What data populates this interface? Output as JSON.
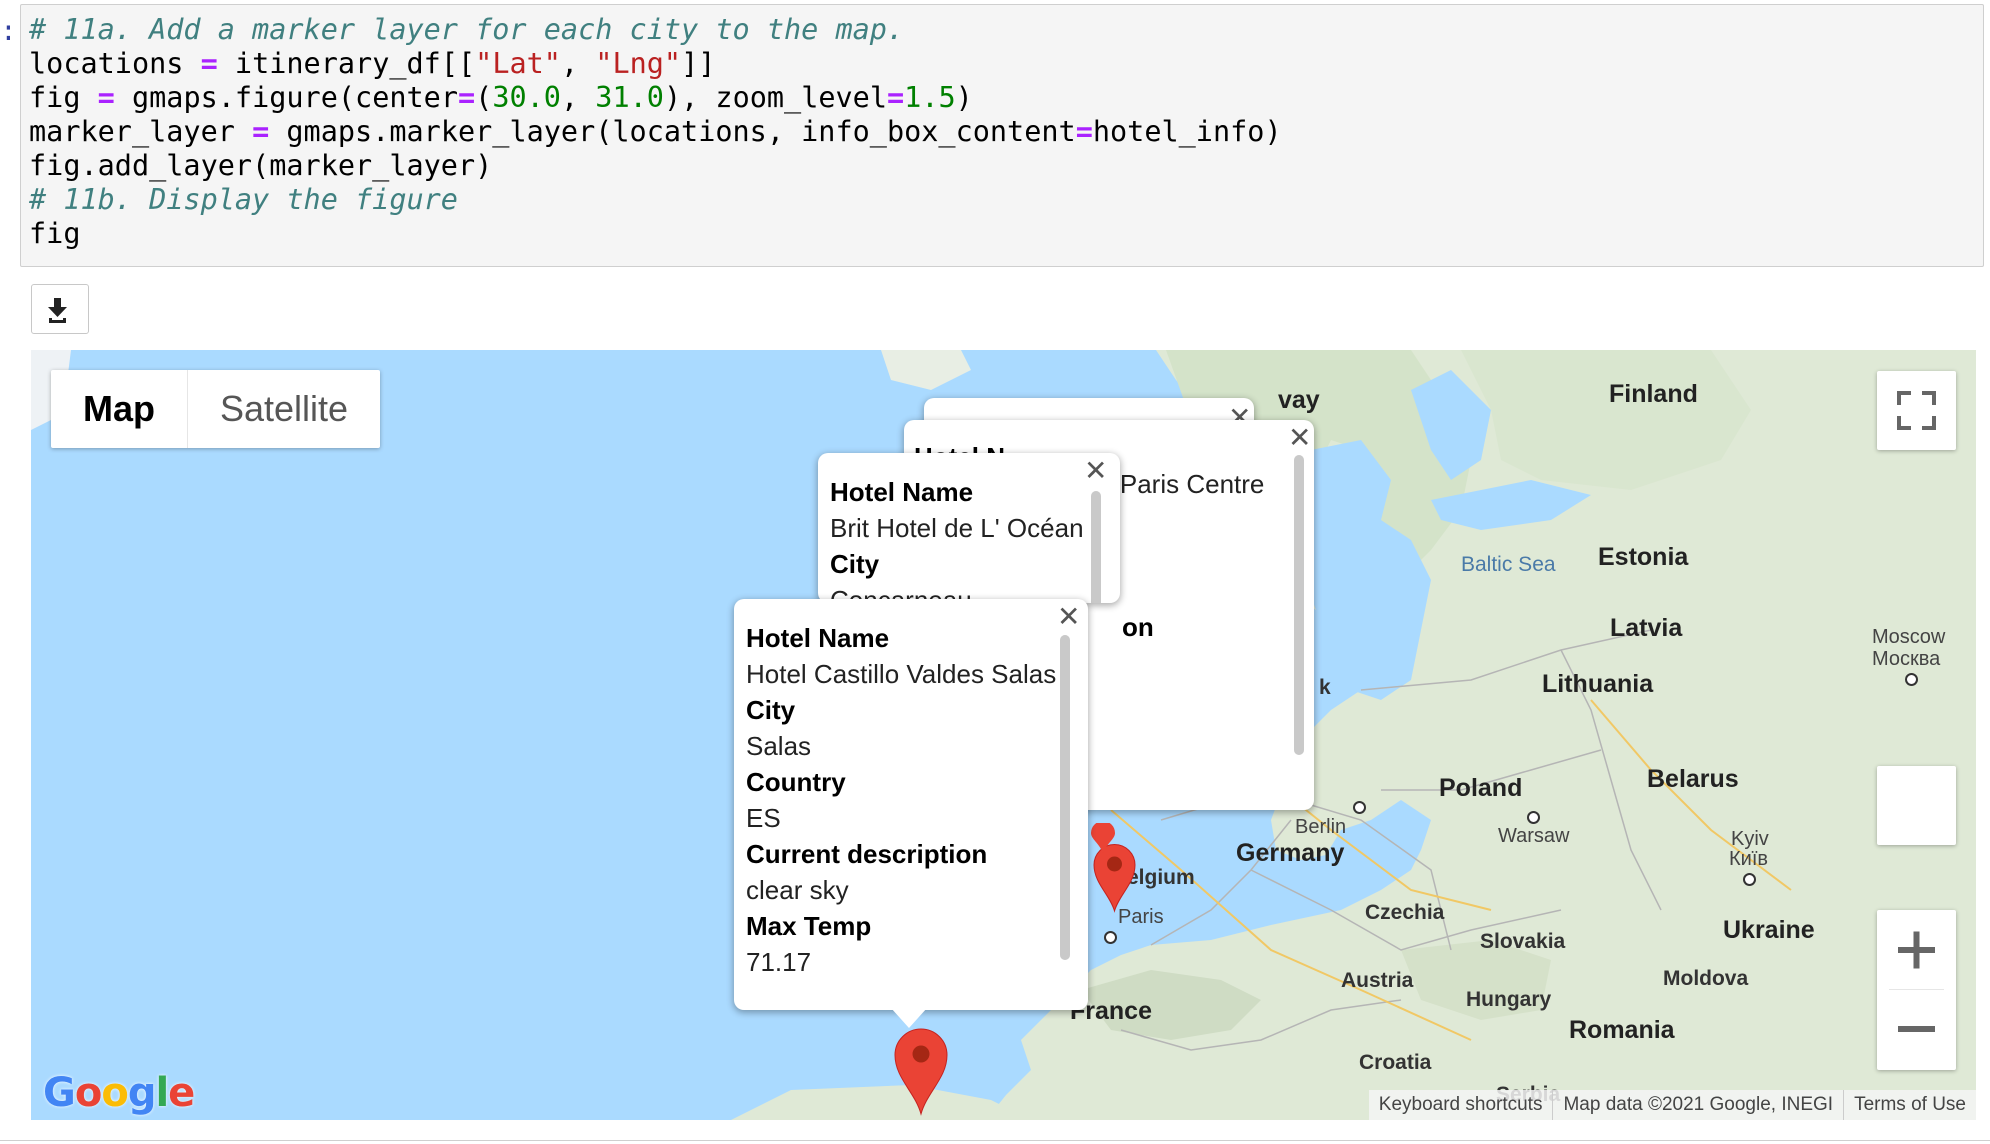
{
  "code_cell": {
    "prompt": ":",
    "lines": {
      "l1": "# 11a. Add a marker layer for each city to the map.",
      "l2a": "locations ",
      "l2b": "=",
      "l2c": " itinerary_df[[",
      "l2d": "\"Lat\"",
      "l2e": ", ",
      "l2f": "\"Lng\"",
      "l2g": "]]",
      "l3a": "fig ",
      "l3b": "=",
      "l3c": " gmaps.figure(center",
      "l3d": "=",
      "l3e": "(",
      "l3f": "30.0",
      "l3g": ", ",
      "l3h": "31.0",
      "l3i": "), zoom_level",
      "l3j": "=",
      "l3k": "1.5",
      "l3l": ")",
      "l4a": "marker_layer ",
      "l4b": "=",
      "l4c": " gmaps.marker_layer(locations, info_box_content",
      "l4d": "=",
      "l4e": "hotel_info)",
      "l5": "fig.add_layer(marker_layer)",
      "l6": "# 11b. Display the figure",
      "l7": "fig"
    }
  },
  "download_button": {
    "icon": "download-icon"
  },
  "map": {
    "map_type": {
      "map_label": "Map",
      "satellite_label": "Satellite"
    },
    "labels": {
      "finland": "Finland",
      "norway_partial": "vay",
      "estonia": "Estonia",
      "latvia": "Latvia",
      "lithuania": "Lithuania",
      "baltic_sea": "Baltic Sea",
      "moscow_en": "Moscow",
      "moscow_ru": "Москва",
      "poland": "Poland",
      "belarus": "Belarus",
      "warsaw": "Warsaw",
      "germany": "Germany",
      "berlin": "Berlin",
      "belgium": "elgium",
      "paris": "Paris",
      "czechia": "Czechia",
      "slovakia": "Slovakia",
      "ukraine": "Ukraine",
      "kyiv_en": "Kyiv",
      "kyiv_uk": "Київ",
      "austria": "Austria",
      "moldova": "Moldova",
      "hungary": "Hungary",
      "romania": "Romania",
      "france": "France",
      "croatia": "Croatia",
      "serbia": "Serbia",
      "k_partial": "k"
    },
    "info_window_back": {
      "partial_text": "- Paris Centre",
      "partial_label": "on",
      "partial_head": "Hotel N"
    },
    "info_window_middle": {
      "hotel_name_label": "Hotel Name",
      "hotel_name": "Brit Hotel de L' Océan",
      "city_label": "City",
      "city_partial": "Concarneau"
    },
    "info_window_front": {
      "hotel_name_label": "Hotel Name",
      "hotel_name": "Hotel Castillo Valdes Salas",
      "city_label": "City",
      "city": "Salas",
      "country_label": "Country",
      "country": "ES",
      "description_label": "Current description",
      "description": "clear sky",
      "max_temp_label": "Max Temp",
      "max_temp": "71.17"
    },
    "footer": {
      "shortcuts": "Keyboard shortcuts",
      "map_data": "Map data ©2021 Google, INEGI",
      "terms": "Terms of Use"
    },
    "logo": {
      "g1": "G",
      "o1": "o",
      "o2": "o",
      "g2": "g",
      "l": "l",
      "e": "e"
    },
    "colors": {
      "water": "#aadaff",
      "land": "#dfe9d6",
      "marker": "#ea4335",
      "marker_dark": "#a52714"
    }
  }
}
